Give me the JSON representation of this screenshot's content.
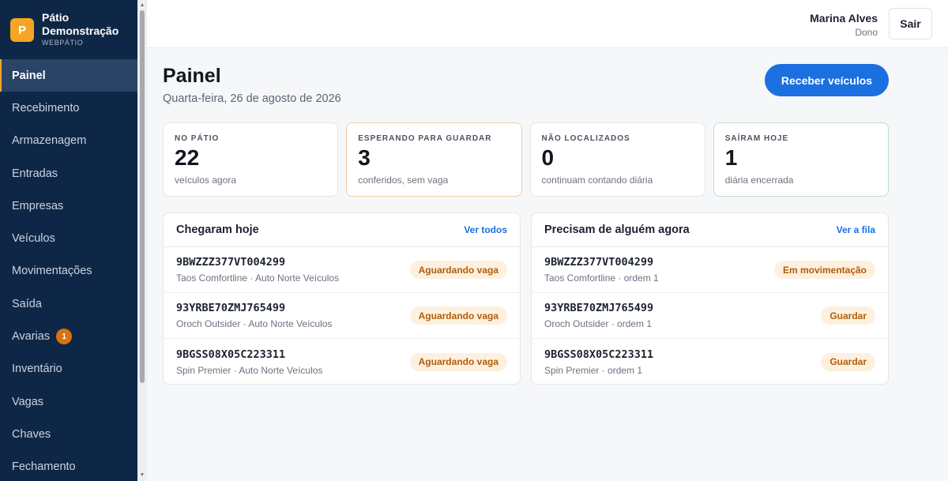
{
  "brand": {
    "logo_letter": "P",
    "name_line1": "Pátio",
    "name_line2": "Demonstração",
    "sub": "WEBPÁTIO"
  },
  "sidebar": {
    "items": [
      {
        "label": "Painel"
      },
      {
        "label": "Recebimento"
      },
      {
        "label": "Armazenagem"
      },
      {
        "label": "Entradas"
      },
      {
        "label": "Empresas"
      },
      {
        "label": "Veículos"
      },
      {
        "label": "Movimentações"
      },
      {
        "label": "Saída"
      },
      {
        "label": "Avarias",
        "badge": "1"
      },
      {
        "label": "Inventário"
      },
      {
        "label": "Vagas"
      },
      {
        "label": "Chaves"
      },
      {
        "label": "Fechamento"
      }
    ]
  },
  "header": {
    "user_name": "Marina Alves",
    "user_role": "Dono",
    "logout_label": "Sair"
  },
  "page": {
    "title": "Painel",
    "date": "Quarta-feira, 26 de agosto de 2026",
    "primary_action": "Receber veículos"
  },
  "stats": [
    {
      "label": "NO PÁTIO",
      "value": "22",
      "note": "veículos agora"
    },
    {
      "label": "ESPERANDO PARA GUARDAR",
      "value": "3",
      "note": "conferidos, sem vaga"
    },
    {
      "label": "NÃO LOCALIZADOS",
      "value": "0",
      "note": "continuam contando diária"
    },
    {
      "label": "SAÍRAM HOJE",
      "value": "1",
      "note": "diária encerrada"
    }
  ],
  "arrived": {
    "title": "Chegaram hoje",
    "link": "Ver todos",
    "rows": [
      {
        "code": "9BWZZZ377VT004299",
        "sub": "Taos Comfortline · Auto Norte Veículos",
        "status": "Aguardando vaga"
      },
      {
        "code": "93YRBE70ZMJ765499",
        "sub": "Oroch Outsider · Auto Norte Veículos",
        "status": "Aguardando vaga"
      },
      {
        "code": "9BGSS08X05C223311",
        "sub": "Spin Premier · Auto Norte Veículos",
        "status": "Aguardando vaga"
      }
    ]
  },
  "queue": {
    "title": "Precisam de alguém agora",
    "link": "Ver a fila",
    "rows": [
      {
        "code": "9BWZZZ377VT004299",
        "sub": "Taos Comfortline · ordem 1",
        "status": "Em movimentação"
      },
      {
        "code": "93YRBE70ZMJ765499",
        "sub": "Oroch Outsider · ordem 1",
        "status": "Guardar"
      },
      {
        "code": "9BGSS08X05C223311",
        "sub": "Spin Premier · ordem 1",
        "status": "Guardar"
      }
    ]
  },
  "colors": {
    "sidebar_bg": "#0f2746",
    "accent": "#f5a524",
    "primary": "#1b6fe0",
    "pill_bg": "#fdf0df",
    "pill_text": "#b25d0a"
  }
}
